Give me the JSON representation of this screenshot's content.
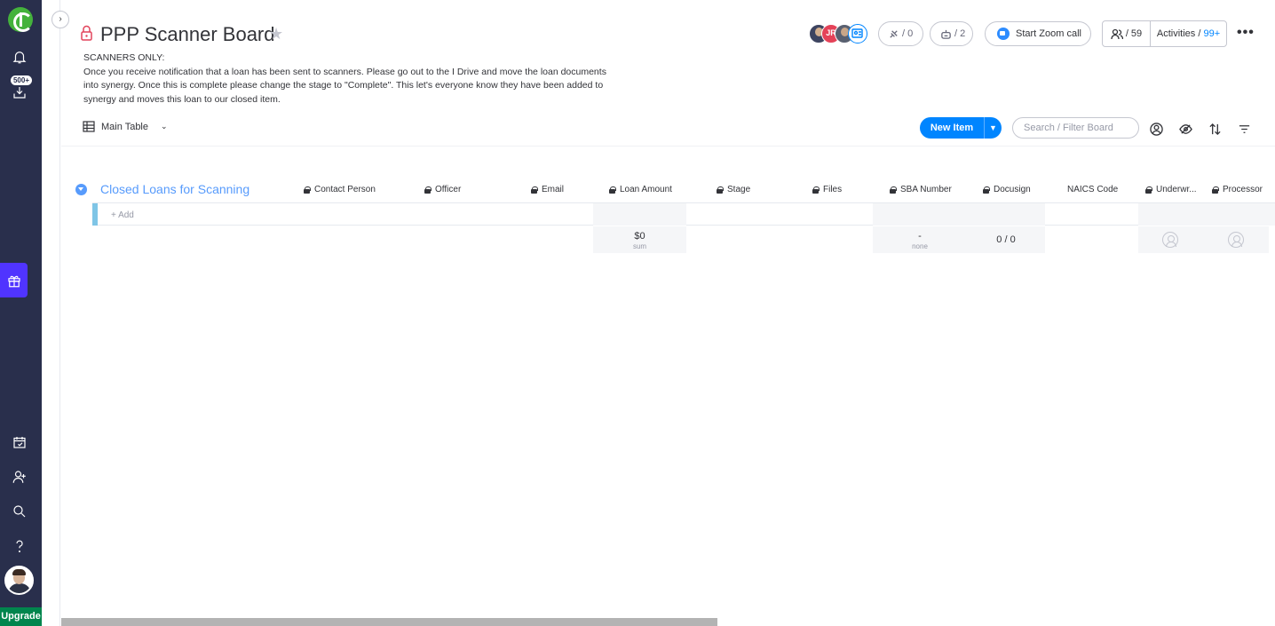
{
  "nav": {
    "notifications_badge": "500+",
    "upgrade_label": "Upgrade",
    "icons": [
      "logo-icon",
      "bell-icon",
      "inbox-icon",
      "gift-icon",
      "my-work-icon",
      "invite-user-icon",
      "search-icon",
      "help-icon"
    ]
  },
  "board": {
    "title": "PPP Scanner Board",
    "description": "SCANNERS ONLY:\nOnce you receive notification that a loan has been sent to scanners. Please go out to the I Drive and move the loan documents into synergy. Once this is complete please change the stage to \"Complete\". This let's everyone know they have been added to synergy and moves this loan to our closed item.",
    "avatar_initials": "JR",
    "integrations_count": "/ 0",
    "automations_count": "/ 2",
    "zoom_label": "Start Zoom call",
    "members_count": "/ 59",
    "activities_label": "Activities /",
    "activities_count": "99+"
  },
  "toolbar": {
    "view_label": "Main Table",
    "new_item_label": "New Item",
    "search_placeholder": "Search / Filter Board"
  },
  "group": {
    "title": "Closed Loans for Scanning",
    "color": "#579bfc",
    "add_label": "+ Add",
    "columns": [
      "Contact Person",
      "Officer",
      "Email",
      "Loan Amount",
      "Stage",
      "Files",
      "SBA Number",
      "Docusign",
      "NAICS Code",
      "Underwr...",
      "Processor"
    ],
    "summary": {
      "loan_amount_value": "$0",
      "loan_amount_label": "sum",
      "sba_value": "-",
      "sba_label": "none",
      "docusign_value": "0 / 0"
    }
  },
  "colors": {
    "nav_bg": "#292f4c",
    "accent": "#0085ff",
    "gift_bg": "#5034ff",
    "upgrade_bg": "#00854d"
  }
}
